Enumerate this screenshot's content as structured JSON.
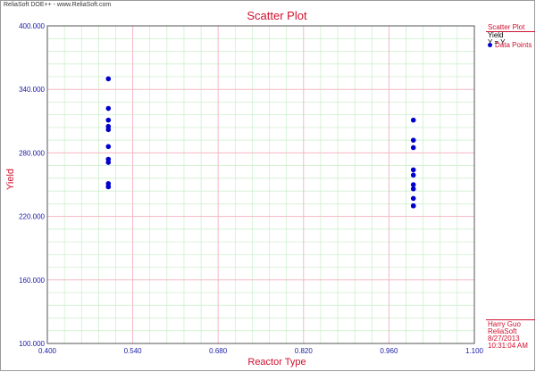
{
  "header": {
    "watermark": "ReliaSoft DOE++ - www.ReliaSoft.com"
  },
  "legend": {
    "title": "Scatter Plot",
    "series_label": "Yield",
    "series_formula": "Y = Y",
    "item_label": "Data Points"
  },
  "footer": {
    "author": "Harry Guo",
    "company": "ReliaSoft",
    "date": "8/27/2013",
    "time": "10:31:04 AM"
  },
  "colors": {
    "title": "#d0102e",
    "axis_text": "#1a1aa6",
    "major_grid": "#f4b8c4",
    "minor_grid": "#c8eec8",
    "marker": "#0000cc"
  },
  "chart_data": {
    "type": "scatter",
    "title": "Scatter Plot",
    "xlabel": "Reactor Type",
    "ylabel": "Yield",
    "xlim": [
      0.4,
      1.1
    ],
    "ylim": [
      100,
      400
    ],
    "x_ticks": [
      "0.400",
      "0.540",
      "0.680",
      "0.820",
      "0.960",
      "1.100"
    ],
    "y_ticks": [
      "100.000",
      "160.000",
      "220.000",
      "280.000",
      "340.000",
      "400.000"
    ],
    "grid": true,
    "legend_position": "right",
    "series": [
      {
        "name": "Data Points",
        "x": [
          0.5,
          0.5,
          0.5,
          0.5,
          0.5,
          0.5,
          0.5,
          0.5,
          0.5,
          0.5,
          0.5,
          1.0,
          1.0,
          1.0,
          1.0,
          1.0,
          1.0,
          1.0,
          1.0,
          1.0,
          1.0
        ],
        "y": [
          350,
          322,
          311,
          305,
          302,
          286,
          274,
          271,
          251,
          248,
          248,
          311,
          292,
          285,
          264,
          259,
          250,
          246,
          237,
          230,
          230
        ]
      }
    ]
  }
}
